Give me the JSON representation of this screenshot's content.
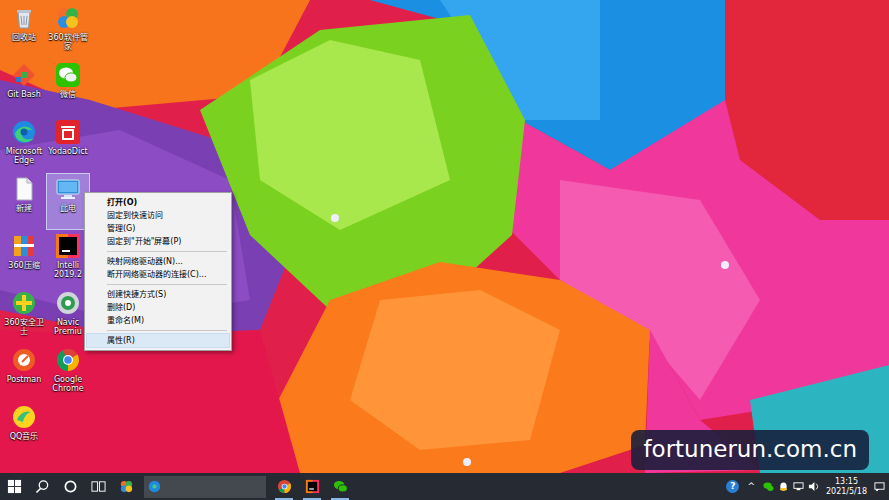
{
  "desktop": {
    "icons": [
      {
        "label": "回收站",
        "kind": "recycle",
        "selected": false
      },
      {
        "label": "Git Bash",
        "kind": "gitbash",
        "selected": false
      },
      {
        "label": "Microsoft Edge",
        "kind": "edge",
        "selected": false
      },
      {
        "label": "新建",
        "kind": "file",
        "selected": false
      },
      {
        "label": "360压缩",
        "kind": "zip360",
        "selected": false
      },
      {
        "label": "360安全卫士",
        "kind": "safe360",
        "selected": false
      },
      {
        "label": "Postman",
        "kind": "postman",
        "selected": false
      },
      {
        "label": "QQ音乐",
        "kind": "qqmusic",
        "selected": false
      },
      {
        "label": "360软件管家",
        "kind": "mgr360",
        "selected": false
      },
      {
        "label": "微信",
        "kind": "wechat",
        "selected": false
      },
      {
        "label": "YodaoDict",
        "kind": "youdao",
        "selected": false
      },
      {
        "label": "此电",
        "kind": "pc",
        "selected": true
      },
      {
        "label": "Intelli 2019.2",
        "kind": "idea",
        "selected": false
      },
      {
        "label": "Navic Premiu",
        "kind": "navicat",
        "selected": false
      },
      {
        "label": "Google Chrome",
        "kind": "chrome",
        "selected": false
      }
    ]
  },
  "context_menu": {
    "items": [
      {
        "kind": "default",
        "label": "打开(O)",
        "highlighted": false
      },
      {
        "kind": "item",
        "label": "固定到快速访问",
        "highlighted": false
      },
      {
        "kind": "item",
        "label": "管理(G)",
        "highlighted": false
      },
      {
        "kind": "item",
        "label": "固定到\"开始\"屏幕(P)",
        "highlighted": false
      },
      {
        "kind": "separator"
      },
      {
        "kind": "item",
        "label": "映射网络驱动器(N)...",
        "highlighted": false
      },
      {
        "kind": "item",
        "label": "断开网络驱动器的连接(C)...",
        "highlighted": false
      },
      {
        "kind": "separator"
      },
      {
        "kind": "item",
        "label": "创建快捷方式(S)",
        "highlighted": false
      },
      {
        "kind": "item",
        "label": "删除(D)",
        "highlighted": false
      },
      {
        "kind": "item",
        "label": "重命名(M)",
        "highlighted": false
      },
      {
        "kind": "separator"
      },
      {
        "kind": "item",
        "label": "属性(R)",
        "highlighted": true
      }
    ]
  },
  "taskbar": {
    "items": [
      {
        "kind": "start",
        "running": false
      },
      {
        "kind": "search",
        "running": false
      },
      {
        "kind": "cortana",
        "running": false
      },
      {
        "kind": "taskview",
        "running": false
      },
      {
        "kind": "app360",
        "running": false
      },
      {
        "kind": "field",
        "running": false
      },
      {
        "kind": "chrome",
        "running": true
      },
      {
        "kind": "idea",
        "running": true
      },
      {
        "kind": "wechat",
        "running": true
      }
    ],
    "tray": {
      "help": "?",
      "chevron": "^",
      "time": "13:15",
      "date": "2021/5/18"
    }
  },
  "watermark": "fortunerun.com.cn"
}
